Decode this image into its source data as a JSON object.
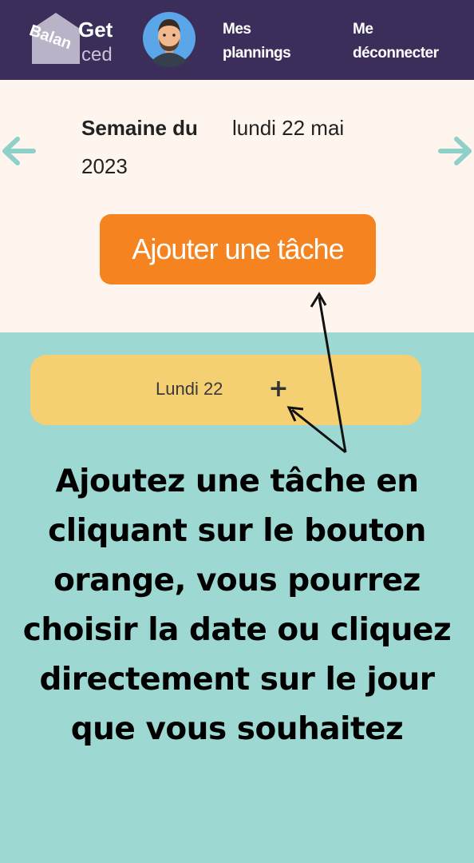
{
  "header": {
    "logo": {
      "get": "Get",
      "balan": "Balan",
      "ced": "ced"
    },
    "avatar_icon": "user-avatar-icon",
    "nav": [
      {
        "line1": "Mes",
        "line2": "plannings"
      },
      {
        "line1": "Me",
        "line2": "déconnecter"
      }
    ]
  },
  "week": {
    "label": "Semaine du",
    "date": "lundi 22 mai",
    "year": "2023",
    "prev_icon": "arrow-left-icon",
    "next_icon": "arrow-right-icon"
  },
  "add_task_label": "Ajouter une tâche",
  "day": {
    "label": "Lundi 22",
    "add": "+"
  },
  "instruction": "Ajoutez une tâche en cliquant sur le bouton orange, vous pourrez choisir la date ou cliquez directement sur le jour que vous souhaitez",
  "colors": {
    "header_bg": "#3c2e5b",
    "week_bg": "#fdf5ee",
    "page_bg": "#9ed8d2",
    "accent_orange": "#f5831f",
    "day_card": "#f5d073",
    "arrow_teal": "#8fd1c9"
  }
}
